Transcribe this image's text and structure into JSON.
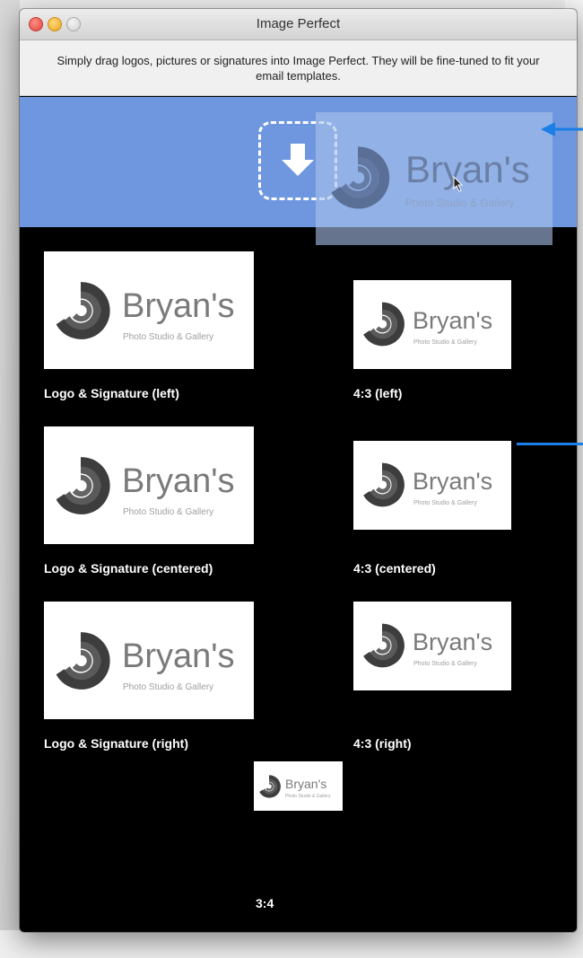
{
  "window": {
    "title": "Image Perfect",
    "instructions": "Simply drag logos, pictures or signatures into Image Perfect. They will be fine-tuned to fit your email templates."
  },
  "logo": {
    "name": "Bryan's",
    "tagline": "Photo Studio & Gallery"
  },
  "templates": [
    {
      "label": "Logo & Signature (left)"
    },
    {
      "label": "4:3 (left)"
    },
    {
      "label": "Logo & Signature (centered)"
    },
    {
      "label": "4:3 (centered)"
    },
    {
      "label": "Logo & Signature (right)"
    },
    {
      "label": "4:3 (right)"
    },
    {
      "label": "3:4"
    }
  ],
  "icons": {
    "drop": "download-arrow-icon",
    "cursor": "mouse-pointer-icon",
    "logo_mark": "swirl-logo-icon"
  },
  "colors": {
    "dropzone": "#6f97df",
    "panel": "#000000",
    "annotation_arrow": "#1a7fe6"
  }
}
